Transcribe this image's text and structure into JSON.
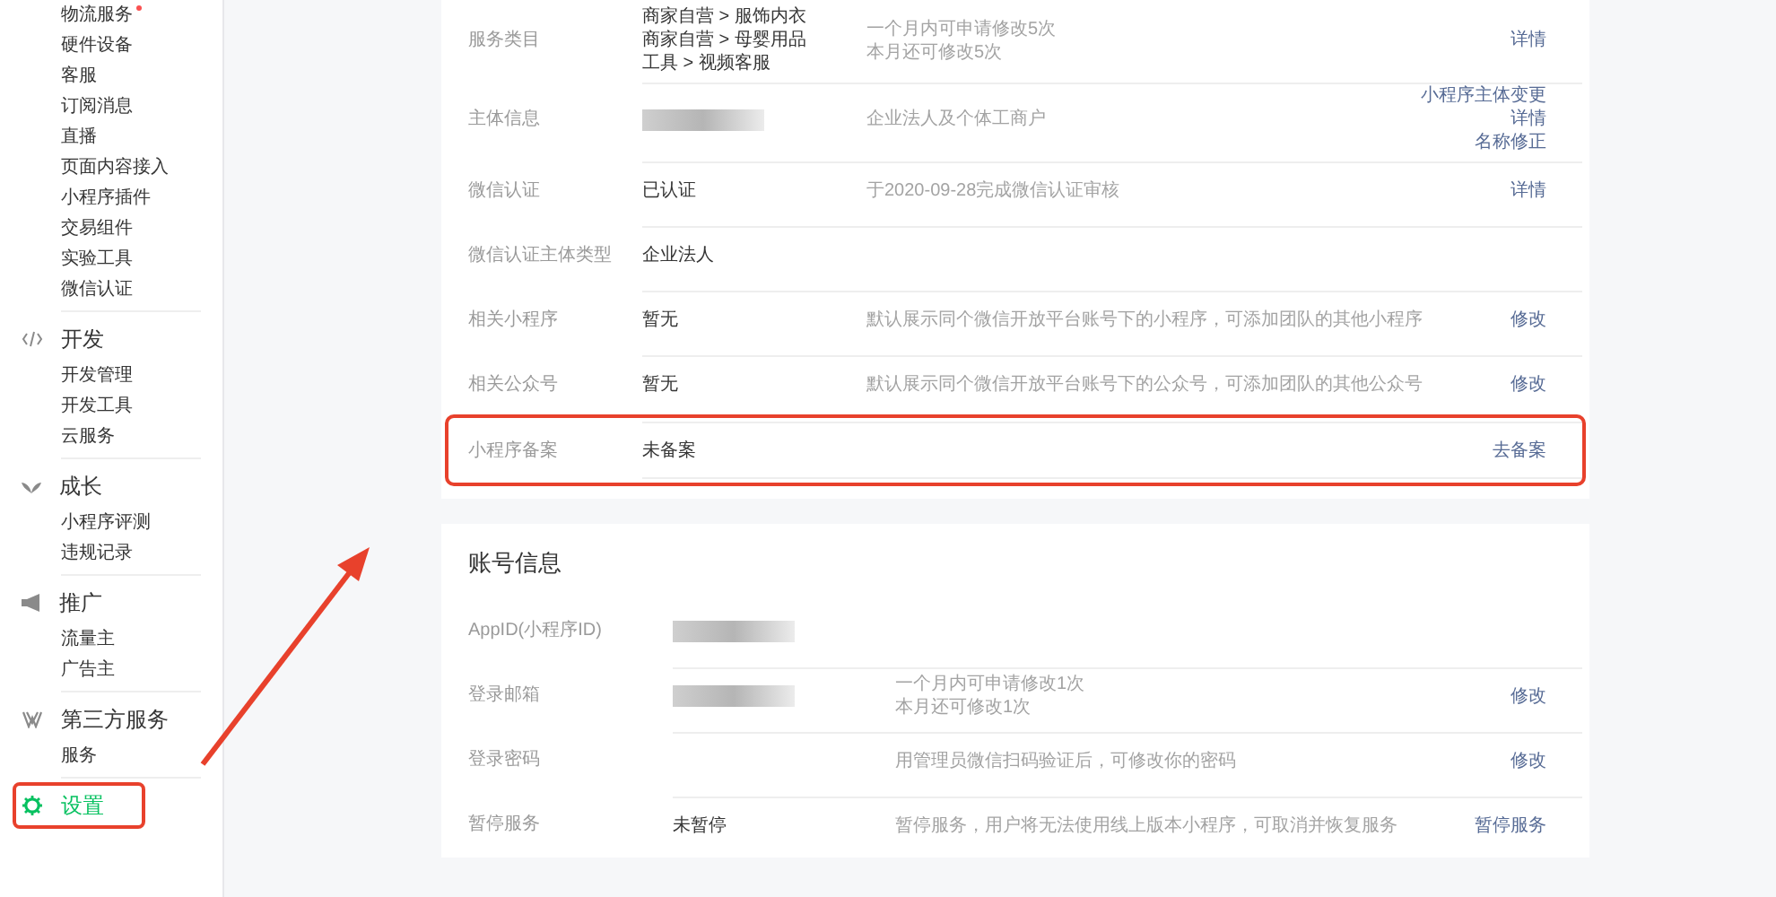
{
  "sidebar": {
    "groups": [
      {
        "items": [
          {
            "label": "物流服务",
            "selected": false,
            "badge": true
          },
          {
            "label": "硬件设备",
            "selected": false
          },
          {
            "label": "客服",
            "selected": false
          },
          {
            "label": "订阅消息",
            "selected": false
          },
          {
            "label": "直播",
            "selected": false
          },
          {
            "label": "页面内容接入",
            "selected": false
          },
          {
            "label": "小程序插件",
            "selected": false
          },
          {
            "label": "交易组件",
            "selected": false
          },
          {
            "label": "实验工具",
            "selected": false
          },
          {
            "label": "微信认证",
            "selected": false
          }
        ]
      },
      {
        "title": "开发",
        "selected": false,
        "items": [
          {
            "label": "开发管理",
            "selected": false
          },
          {
            "label": "开发工具",
            "selected": false
          },
          {
            "label": "云服务",
            "selected": false
          }
        ]
      },
      {
        "title": "成长",
        "selected": false,
        "items": [
          {
            "label": "小程序评测",
            "selected": false
          },
          {
            "label": "违规记录",
            "selected": false
          }
        ]
      },
      {
        "title": "推广",
        "selected": false,
        "items": [
          {
            "label": "流量主",
            "selected": false
          },
          {
            "label": "广告主",
            "selected": false
          }
        ]
      },
      {
        "title": "第三方服务",
        "selected": false,
        "items": [
          {
            "label": "服务",
            "selected": false
          }
        ]
      },
      {
        "title": "设置",
        "selected": true,
        "highlighted": true
      }
    ]
  },
  "basic_info": {
    "rows": [
      {
        "label": "服务类目",
        "value": [
          "商家自营 > 服饰内衣",
          "商家自营 > 母婴用品",
          "工具 > 视频客服"
        ],
        "note": [
          "一个月内可申请修改5次",
          "本月还可修改5次"
        ],
        "actions": [
          "详情"
        ]
      },
      {
        "label": "主体信息",
        "redacted": true,
        "note": [
          "企业法人及个体工商户"
        ],
        "actions": [
          "小程序主体变更",
          "详情",
          "名称修正"
        ]
      },
      {
        "label": "微信认证",
        "value": [
          "已认证"
        ],
        "note": [
          "于2020-09-28完成微信认证审核"
        ],
        "actions": [
          "详情"
        ]
      },
      {
        "label": "微信认证主体类型",
        "value": [
          "企业法人"
        ]
      },
      {
        "label": "相关小程序",
        "value": [
          "暂无"
        ],
        "note": [
          "默认展示同个微信开放平台账号下的小程序，可添加团队的其他小程序"
        ],
        "actions": [
          "修改"
        ]
      },
      {
        "label": "相关公众号",
        "value": [
          "暂无"
        ],
        "note": [
          "默认展示同个微信开放平台账号下的公众号，可添加团队的其他公众号"
        ],
        "actions": [
          "修改"
        ]
      },
      {
        "label": "小程序备案",
        "value": [
          "未备案"
        ],
        "actions": [
          "去备案"
        ],
        "highlighted": true
      }
    ]
  },
  "account_info": {
    "title": "账号信息",
    "rows": [
      {
        "label": "AppID(小程序ID)",
        "redacted": true
      },
      {
        "label": "登录邮箱",
        "redacted": true,
        "note": [
          "一个月内可申请修改1次",
          "本月还可修改1次"
        ],
        "actions": [
          "修改"
        ]
      },
      {
        "label": "登录密码",
        "note": [
          "用管理员微信扫码验证后，可修改你的密码"
        ],
        "actions": [
          "修改"
        ]
      },
      {
        "label": "暂停服务",
        "value": [
          "未暂停"
        ],
        "note": [
          "暂停服务，用户将无法使用线上版本小程序，可取消并恢复服务"
        ],
        "actions": [
          "暂停服务"
        ]
      }
    ]
  }
}
